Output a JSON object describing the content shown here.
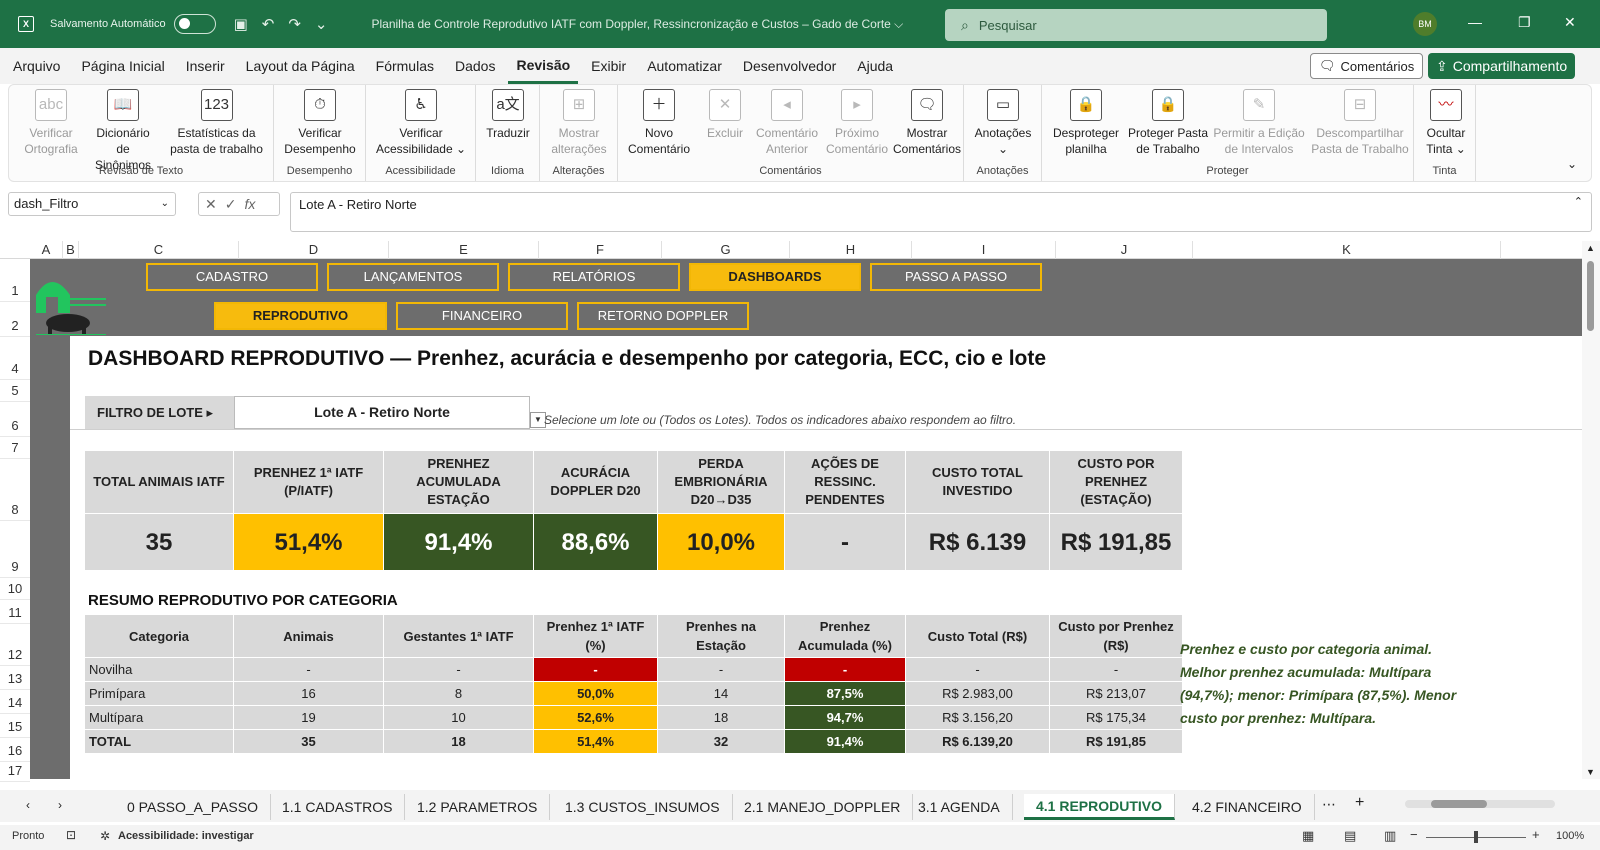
{
  "titlebar": {
    "autosave": "Salvamento Automático",
    "doc_title": "Planilha de Controle Reprodutivo IATF com Doppler, Ressincronização e Custos – Gado de Corte ⌵",
    "search_placeholder": "Pesquisar",
    "avatar": "BM"
  },
  "menu": [
    "Arquivo",
    "Página Inicial",
    "Inserir",
    "Layout da Página",
    "Fórmulas",
    "Dados",
    "Revisão",
    "Exibir",
    "Automatizar",
    "Desenvolvedor",
    "Ajuda"
  ],
  "menu_active": "Revisão",
  "comments_btn": "Comentários",
  "share_btn": "Compartilhamento",
  "ribbon": {
    "verif_ortografia": "Verificar\nOrtografia",
    "dicionario": "Dicionário\nde Sinônimos",
    "estatisticas": "Estatísticas da\npasta de trabalho",
    "g_revisao": "Revisão de Texto",
    "verif_desempenho": "Verificar\nDesempenho",
    "g_desempenho": "Desempenho",
    "verif_acess": "Verificar\nAcessibilidade ⌄",
    "g_acess": "Acessibilidade",
    "traduzir": "Traduzir",
    "g_idioma": "Idioma",
    "mostrar_alt": "Mostrar\nalterações",
    "g_alt": "Alterações",
    "novo_coment": "Novo\nComentário",
    "excluir": "Excluir",
    "coment_ant": "Comentário\nAnterior",
    "prox_coment": "Próximo\nComentário",
    "mostrar_coment": "Mostrar\nComentários",
    "g_coment": "Comentários",
    "anotacoes": "Anotações\n⌄",
    "g_anot": "Anotações",
    "desproteger": "Desproteger\nplanilha",
    "proteger_pasta": "Proteger Pasta\nde Trabalho",
    "permitir": "Permitir a Edição\nde Intervalos",
    "descompart": "Descompartilhar\nPasta de Trabalho",
    "g_proteger": "Proteger",
    "ocultar_tinta": "Ocultar\nTinta ⌄",
    "g_tinta": "Tinta"
  },
  "formula_bar": {
    "name_box": "dash_Filtro",
    "formula": "Lote A - Retiro Norte"
  },
  "columns": [
    "A",
    "B",
    "C",
    "D",
    "E",
    "F",
    "G",
    "H",
    "I",
    "J",
    "K"
  ],
  "rows": [
    "1",
    "2",
    "4",
    "5",
    "6",
    "7",
    "8",
    "9",
    "10",
    "11",
    "12",
    "13",
    "14",
    "15",
    "16",
    "17"
  ],
  "nav_top": [
    "CADASTRO",
    "LANÇAMENTOS",
    "RELATÓRIOS",
    "DASHBOARDS",
    "PASSO A PASSO"
  ],
  "nav_sub": [
    "REPRODUTIVO",
    "FINANCEIRO",
    "RETORNO DOPPLER"
  ],
  "dashboard_title": "DASHBOARD REPRODUTIVO — Prenhez, acurácia e desempenho por categoria, ECC, cio e lote",
  "filter": {
    "label": "FILTRO DE LOTE ▸",
    "value": "Lote A - Retiro Norte",
    "hint": "Selecione um lote ou (Todos os Lotes). Todos os indicadores abaixo respondem ao filtro."
  },
  "kpis": [
    {
      "label": "TOTAL ANIMAIS IATF",
      "value": "35",
      "color": "#d9d9d9"
    },
    {
      "label": "PRENHEZ 1ª IATF (P/IATF)",
      "value": "51,4%",
      "color": "#ffc000"
    },
    {
      "label": "PRENHEZ ACUMULADA ESTAÇÃO",
      "value": "91,4%",
      "color": "#375623"
    },
    {
      "label": "ACURÁCIA DOPPLER D20",
      "value": "88,6%",
      "color": "#375623"
    },
    {
      "label": "PERDA EMBRIONÁRIA D20→D35",
      "value": "10,0%",
      "color": "#ffc000"
    },
    {
      "label": "AÇÕES DE RESSINC. PENDENTES",
      "value": "-",
      "color": "#d9d9d9"
    },
    {
      "label": "CUSTO TOTAL INVESTIDO",
      "value": "R$ 6.139",
      "color": "#d9d9d9"
    },
    {
      "label": "CUSTO POR PRENHEZ (ESTAÇÃO)",
      "value": "R$ 191,85",
      "color": "#d9d9d9"
    }
  ],
  "summary": {
    "title": "RESUMO REPRODUTIVO POR CATEGORIA",
    "headers": [
      "Categoria",
      "Animais",
      "Gestantes 1ª IATF",
      "Prenhez 1ª IATF (%)",
      "Prenhes na Estação",
      "Prenhez Acumulada (%)",
      "Custo Total (R$)",
      "Custo por Prenhez (R$)"
    ],
    "rows": [
      [
        "Novilha",
        "-",
        "-",
        "-",
        "-",
        "-",
        "-",
        "-"
      ],
      [
        "Primípara",
        "16",
        "8",
        "50,0%",
        "14",
        "87,5%",
        "R$ 2.983,00",
        "R$ 213,07"
      ],
      [
        "Multípara",
        "19",
        "10",
        "52,6%",
        "18",
        "94,7%",
        "R$ 3.156,20",
        "R$ 175,34"
      ],
      [
        "TOTAL",
        "35",
        "18",
        "51,4%",
        "32",
        "91,4%",
        "R$ 6.139,20",
        "R$ 191,85"
      ]
    ],
    "note": "Prenhez e custo por categoria animal. Melhor prenhez acumulada: Multípara (94,7%); menor: Primípara (87,5%). Menor custo por prenhez: Multípara."
  },
  "sheet_tabs": [
    "0 PASSO_A_PASSO",
    "1.1 CADASTROS",
    "1.2 PARAMETROS",
    "1.3 CUSTOS_INSUMOS",
    "2.1 MANEJO_DOPPLER",
    "3.1 AGENDA",
    "4.1 REPRODUTIVO",
    "4.2 FINANCEIRO"
  ],
  "active_tab": "4.1 REPRODUTIVO",
  "status": {
    "ready": "Pronto",
    "accessibility": "Acessibilidade: investigar",
    "zoom": "100%"
  }
}
